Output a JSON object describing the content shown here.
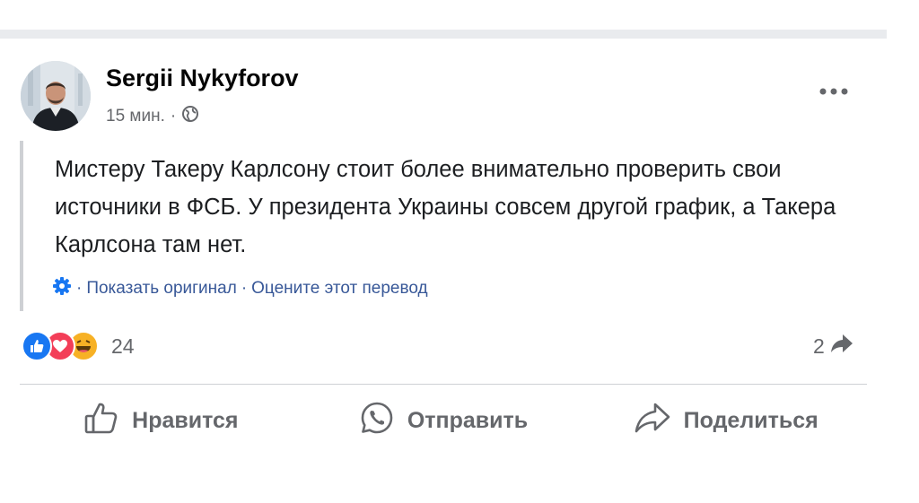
{
  "post": {
    "author": "Sergii Nykyforov",
    "time": "15 мин.",
    "time_separator": "·",
    "body": "Мистеру Такеру Карлсону стоит более внимательно проверить свои источники в ФСБ. У президента Украины совсем другой график, а Такера Карлсона там нет.",
    "translation": {
      "prefix_separator": "·",
      "show_original": "Показать оригинал",
      "separator": "·",
      "rate": "Оцените этот перевод"
    },
    "reactions": {
      "types": [
        "like",
        "love",
        "haha"
      ],
      "count": "24"
    },
    "shares": {
      "count": "2"
    },
    "actions": {
      "like": "Нравится",
      "send": "Отправить",
      "share": "Поделиться"
    }
  },
  "colors": {
    "like_blue": "#1877f2",
    "love_red": "#f33e58",
    "haha_yellow": "#f7b125",
    "link_blue": "#385898",
    "muted_gray": "#65676b"
  },
  "icons": {
    "privacy": "globe-icon",
    "more": "more-dots-icon",
    "translate": "gear-icon",
    "share_count": "share-arrow-icon",
    "like": "thumbs-up-icon",
    "send": "whatsapp-icon",
    "share": "share-icon"
  }
}
